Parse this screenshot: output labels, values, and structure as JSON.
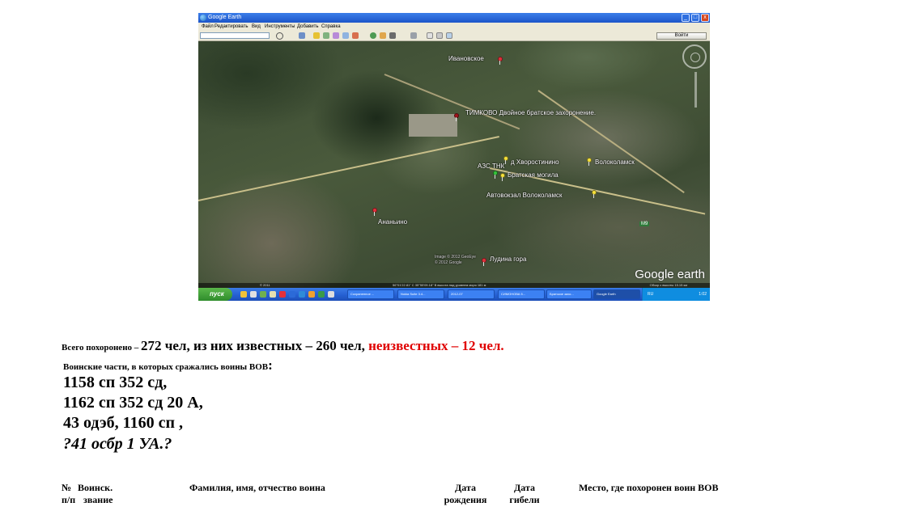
{
  "window": {
    "title": "Google Earth",
    "buttons": [
      "_",
      "□",
      "x"
    ]
  },
  "menu": [
    "Файл",
    "Редактировать",
    "Вид",
    "Инструменты",
    "Добавить",
    "Справка"
  ],
  "search_button": "Войти",
  "map": {
    "places": [
      {
        "label": "Ивановское",
        "pin": "red"
      },
      {
        "label": "ТИМКОВО  Двойное братское захоронение.",
        "pin": "dark-red"
      },
      {
        "label": "д Хворостинино",
        "pin": "yellow"
      },
      {
        "label": "Волоколамск",
        "pin": "yellow"
      },
      {
        "label": "АЗС ТНК",
        "pin": "green"
      },
      {
        "label": "Братская могила",
        "pin": "yellow"
      },
      {
        "label": "Автовокзал  Волоколамск",
        "pin": "yellow"
      },
      {
        "label": "Ананьино",
        "pin": "red"
      },
      {
        "label": "Лудина гора",
        "pin": "red"
      }
    ],
    "road_badge": "М9",
    "logo": "Google earth",
    "status_left": "© 2011",
    "status_coords": "56°01'22.81\" С  35°55'09.18\" В  высота над уровнем моря   181 м",
    "status_right": "Обзор с высоты   15.15 км",
    "copyright_1": "Image © 2012 GeoEye",
    "copyright_2": "© 2012 Google"
  },
  "taskbar": {
    "start": "пуск",
    "tasks": [
      "Сохраненное ...",
      "Nokia Suite 3.4...",
      "2012-07",
      "СИМОНОВА  5...",
      "Братское захо...",
      "Google Earth"
    ],
    "lang": "RU",
    "clock": "1:02"
  },
  "doc": {
    "total_prefix": "Всего похоронено – ",
    "total_main": "272 чел, из них известных – 260 чел, ",
    "total_unknown": "неизвестных – 12 чел.",
    "units_prefix": "Воинские части, в которых сражались воины ВОВ",
    "units_colon": ":",
    "unit_lines": [
      "1158 сп 352 сд,",
      "1162 сп 352 сд 20 А,",
      "43 одэб, 1160 сп ,",
      "?41 осбр  1 УА.?"
    ]
  },
  "table_header": {
    "col_num_1": "№",
    "col_num_2": "п/п",
    "col_rank_1": "Воинск.",
    "col_rank_2": "звание",
    "col_name": "Фамилия, имя, отчество воина",
    "col_birth_1": "Дата",
    "col_birth_2": "рождения",
    "col_death_1": "Дата",
    "col_death_2": "гибели",
    "col_place": "Место, где похоронен воин ВОВ"
  }
}
